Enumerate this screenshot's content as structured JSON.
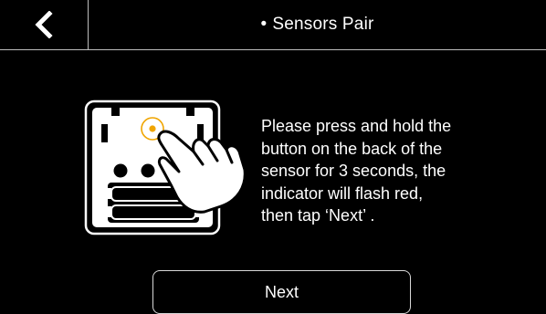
{
  "header": {
    "back_icon": "chevron-left-icon",
    "title_bullet": "•",
    "title": "Sensors Pair"
  },
  "illustration": {
    "icon": "sensor-press-button-icon",
    "indicator_color": "#f0a500"
  },
  "instructions": {
    "text": "Please press and hold the\nbutton on the back of the\nsensor for 3 seconds, the\nindicator will flash red,\nthen tap ‘Next’ ."
  },
  "next_button": {
    "label": "Next"
  },
  "colors": {
    "background": "#000000",
    "foreground": "#ffffff",
    "divider": "#bdbdbd"
  }
}
